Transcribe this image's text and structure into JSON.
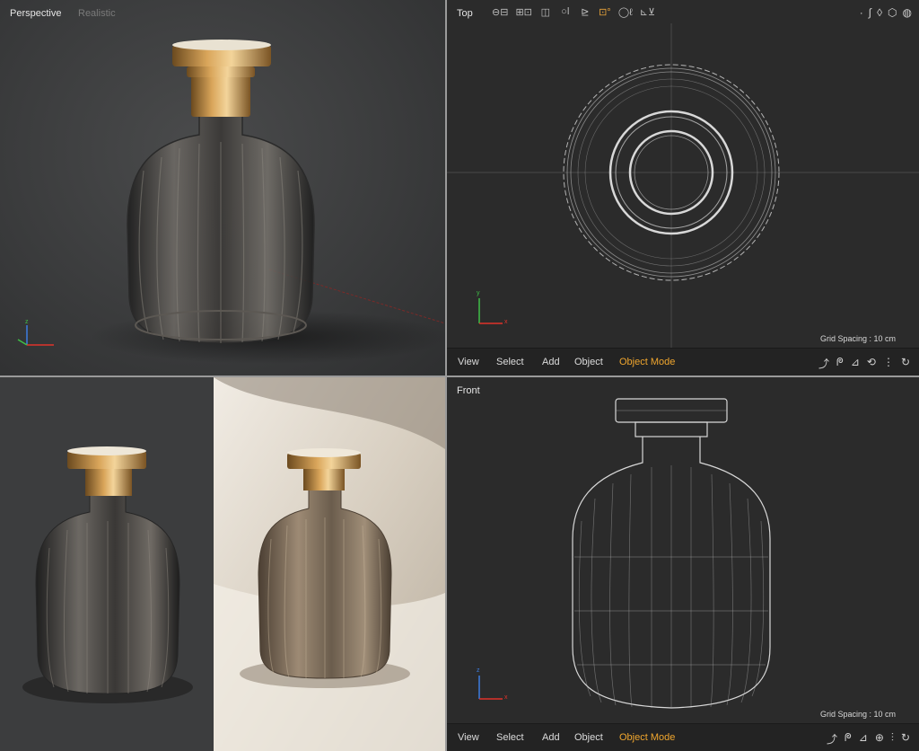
{
  "viewports": {
    "perspective": {
      "title": "Perspective",
      "shading": "Realistic"
    },
    "top": {
      "title": "Top",
      "grid_spacing": "Grid Spacing : 10 cm"
    },
    "front": {
      "title": "Front",
      "grid_spacing": "Grid Spacing : 10 cm"
    }
  },
  "menubar": {
    "view": "View",
    "select": "Select",
    "add": "Add",
    "object": "Object",
    "mode": "Object Mode"
  },
  "toolbar": {
    "icons": [
      "frame-icon",
      "frame-alt-icon",
      "split-icon",
      "layers-icon",
      "circle-icon",
      "edit-icon",
      "lock-icon",
      "ring-icon",
      "bend-icon"
    ],
    "right_icons": [
      "curve-icon",
      "drop-icon",
      "cube-icon"
    ]
  },
  "axes": {
    "x": "x",
    "y": "y",
    "z": "z"
  },
  "colors": {
    "accent": "#f0a62e",
    "x_axis": "#e0332b",
    "y_axis": "#3fbf47",
    "z_axis": "#3d7de0"
  }
}
